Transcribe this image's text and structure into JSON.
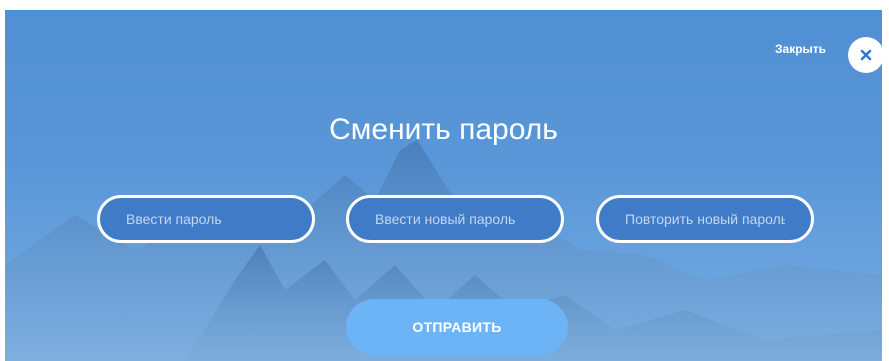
{
  "modal": {
    "close_label": "Закрыть",
    "close_icon": "close-icon",
    "title": "Сменить пароль",
    "fields": [
      {
        "placeholder": "Ввести пароль",
        "value": ""
      },
      {
        "placeholder": "Ввести новый пароль",
        "value": ""
      },
      {
        "placeholder": "Повторить новый пароль",
        "value": ""
      }
    ],
    "submit_label": "ОТПРАВИТЬ"
  },
  "colors": {
    "background": "#5a97d8",
    "field_fill": "#3f7bc7",
    "field_border": "#ffffff",
    "submit_button": "#6db4f6",
    "close_icon": "#2f7ad0"
  }
}
